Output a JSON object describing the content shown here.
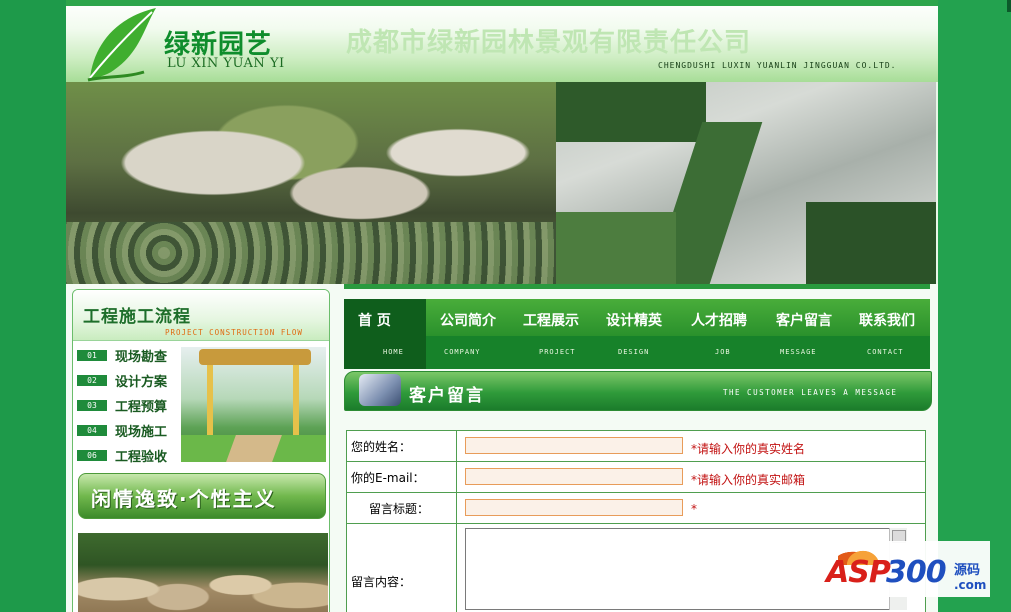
{
  "header": {
    "logo_cn": "绿新园艺",
    "logo_en": "LU XIN YUAN YI",
    "company_cn": "成都市绿新园林景观有限责任公司",
    "company_en": "CHENGDUSHI LUXIN YUANLIN JINGGUAN CO.LTD."
  },
  "sidebar": {
    "title": "工程施工流程",
    "subtitle": "PROJECT CONSTRUCTION FLOW",
    "steps": [
      {
        "num": "01",
        "label": "现场勘查"
      },
      {
        "num": "02",
        "label": "设计方案"
      },
      {
        "num": "03",
        "label": "工程预算"
      },
      {
        "num": "04",
        "label": "现场施工"
      },
      {
        "num": "06",
        "label": "工程验收"
      }
    ],
    "slogan": "闲情逸致·个性主义"
  },
  "nav": {
    "items": [
      {
        "cn": "首 页",
        "en": "HOME"
      },
      {
        "cn": "公司简介",
        "en": "COMPANY"
      },
      {
        "cn": "工程展示",
        "en": "PROJECT"
      },
      {
        "cn": "设计精英",
        "en": "DESIGN"
      },
      {
        "cn": "人才招聘",
        "en": "JOB"
      },
      {
        "cn": "客户留言",
        "en": "MESSAGE"
      },
      {
        "cn": "联系我们",
        "en": "CONTACT"
      }
    ]
  },
  "section": {
    "title": "客户留言",
    "subtitle": "THE CUSTOMER LEAVES A MESSAGE"
  },
  "form": {
    "name_label": "您的姓名：",
    "name_value": "",
    "name_hint": "*请输入你的真实姓名",
    "email_label": "你的E-mail：",
    "email_value": "",
    "email_hint": "*请输入你的真实邮箱",
    "subject_label": "留言标题：",
    "subject_value": "",
    "subject_hint": "*",
    "content_label": "留言内容：",
    "content_value": ""
  },
  "watermark": {
    "asp": "ASP",
    "num": "300",
    "yuan": "源码",
    "com": ".com"
  },
  "colors": {
    "brand_green": "#1e9a4a",
    "nav_green": "#1e8a2a",
    "hint_red": "#c21212",
    "input_border": "#e89c5a"
  }
}
